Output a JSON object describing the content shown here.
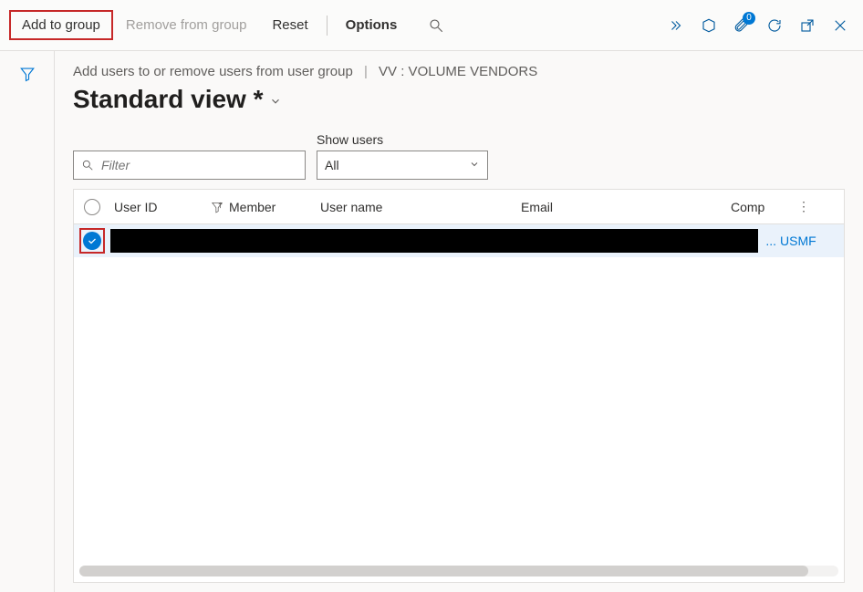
{
  "toolbar": {
    "add_to_group": "Add to group",
    "remove_from_group": "Remove from group",
    "reset": "Reset",
    "options": "Options",
    "attachment_badge": "0"
  },
  "breadcrumb": {
    "line1": "Add users to or remove users from user group",
    "line2": "VV : VOLUME VENDORS"
  },
  "view": {
    "title": "Standard view *"
  },
  "filter": {
    "placeholder": "Filter"
  },
  "show_users": {
    "label": "Show users",
    "value": "All"
  },
  "grid": {
    "columns": {
      "user_id": "User ID",
      "member": "Member",
      "user_name": "User name",
      "email": "Email",
      "company": "Comp"
    },
    "rows": [
      {
        "selected": true,
        "user_id": "",
        "member": "",
        "user_name": "",
        "email": "",
        "truncated": "...",
        "company": "USMF"
      }
    ]
  }
}
